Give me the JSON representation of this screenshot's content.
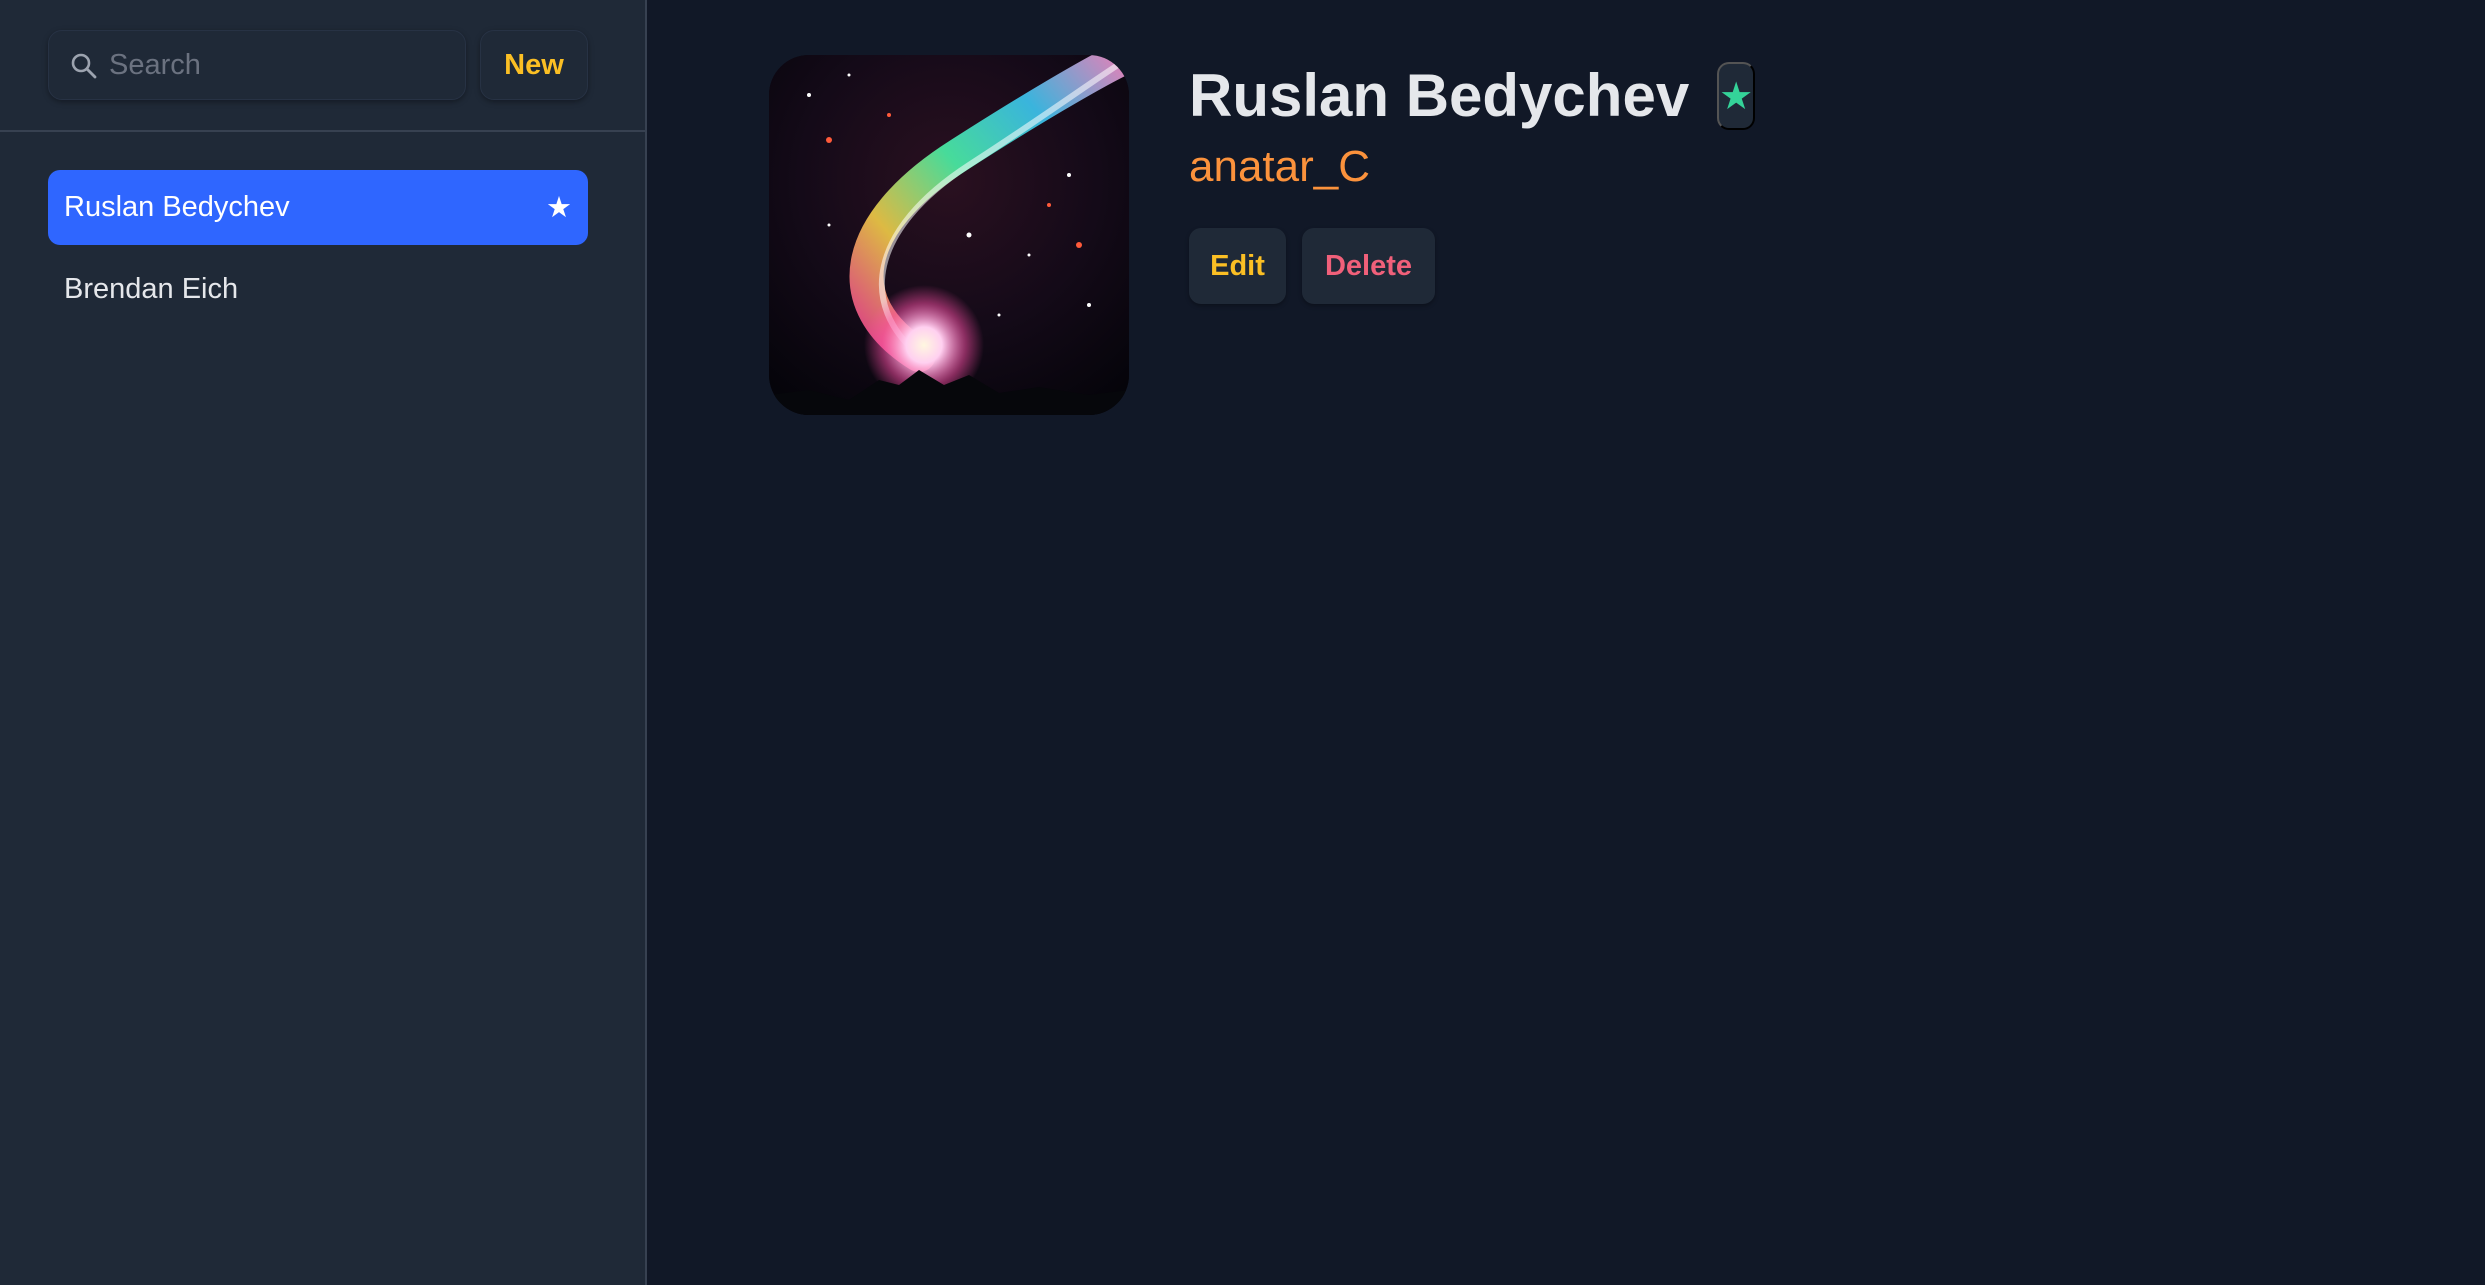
{
  "sidebar": {
    "search": {
      "placeholder": "Search",
      "value": ""
    },
    "new_label": "New",
    "contacts": [
      {
        "name": "Ruslan Bedychev",
        "favorite_icon": "★",
        "active": true
      },
      {
        "name": "Brendan Eich",
        "active": false
      }
    ]
  },
  "contact": {
    "name": "Ruslan Bedychev",
    "favorite_icon": "★",
    "handle": "anatar_C",
    "avatar_icon": "comet-night-sky-image",
    "edit_label": "Edit",
    "delete_label": "Delete"
  },
  "colors": {
    "background": "#111827",
    "sidebar": "#1f2937",
    "active": "#2f66ff",
    "accent_yellow": "#fbbf24",
    "handle_orange": "#fb923c",
    "favorite_green": "#34d399",
    "delete_red": "#f0607a"
  }
}
